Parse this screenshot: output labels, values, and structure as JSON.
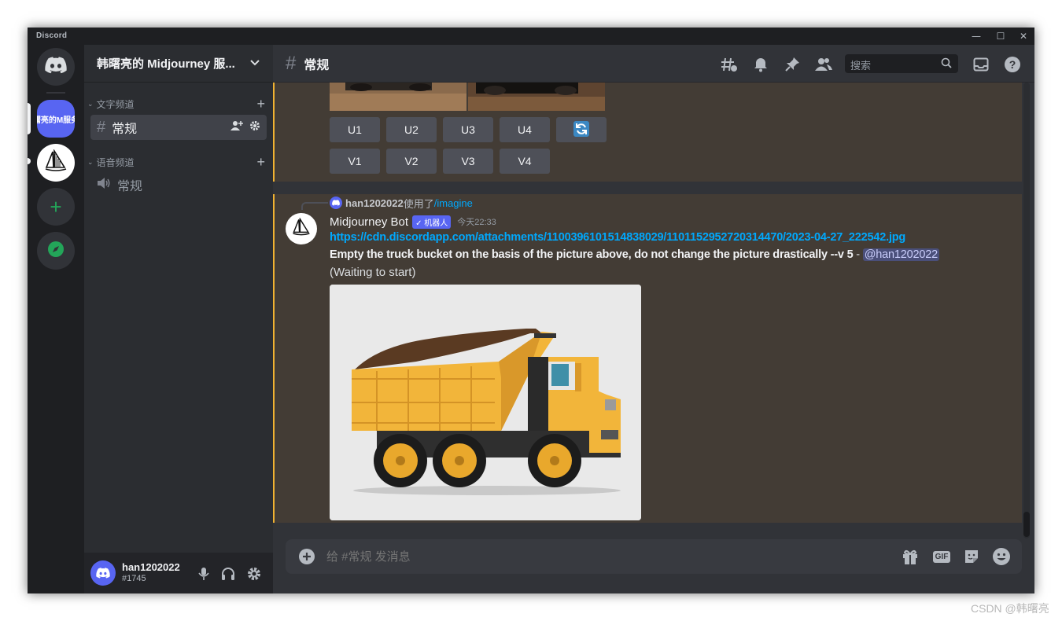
{
  "window": {
    "app_name": "Discord",
    "controls": {
      "minimize": "—",
      "maximize": "☐",
      "close": "✕"
    }
  },
  "servers": {
    "items": [
      {
        "name": "home",
        "icon": "discord-logo"
      },
      {
        "name": "韩曙亮的M服务器",
        "abbr": "曙亮的M服务",
        "selected": true
      },
      {
        "name": "midjourney",
        "icon": "sailboat-icon"
      },
      {
        "name": "add-server",
        "icon": "plus-icon"
      },
      {
        "name": "explore",
        "icon": "compass-icon"
      }
    ]
  },
  "sidebar": {
    "guild_name": "韩曙亮的 Midjourney 服...",
    "categories": [
      {
        "label": "文字频道",
        "channels": [
          {
            "name": "常规",
            "type": "text",
            "active": true
          }
        ]
      },
      {
        "label": "语音频道",
        "channels": [
          {
            "name": "常规",
            "type": "voice"
          }
        ]
      }
    ]
  },
  "user": {
    "name": "han1202022",
    "tag": "#1745"
  },
  "channel_header": {
    "name": "常规",
    "search_placeholder": "搜索",
    "icons": [
      "threads-icon",
      "bell-icon",
      "pin-icon",
      "members-icon",
      "inbox-icon",
      "help-icon"
    ]
  },
  "previous_message": {
    "buttons_row1": [
      "U1",
      "U2",
      "U3",
      "U4"
    ],
    "reroll_icon": "refresh-icon",
    "buttons_row2": [
      "V1",
      "V2",
      "V3",
      "V4"
    ]
  },
  "message": {
    "reply_user": "han1202022",
    "reply_action": "使用了",
    "reply_command": "/imagine",
    "author": "Midjourney Bot",
    "bot_badge": "✓ 机器人",
    "timestamp": "今天22:33",
    "link": "https://cdn.discordapp.com/attachments/1100396101514838029/1101152952720314470/2023-04-27_222542.jpg",
    "prompt": "Empty the truck bucket on the basis of the picture above, do not change the picture drastically --v 5",
    "separator": " - ",
    "mention": "@han1202022",
    "status": "(Waiting to start)"
  },
  "composer": {
    "placeholder": "给 #常规 发消息",
    "gif_label": "GIF",
    "icons": [
      "add-attachment-icon",
      "gift-icon",
      "gif-icon",
      "sticker-icon",
      "emoji-icon"
    ]
  },
  "watermark": "CSDN @韩曙亮",
  "colors": {
    "accent": "#5865f2",
    "link": "#00a8fc",
    "mention_bg": "#4a4f7a",
    "highlight_bar": "#f0b232",
    "highlight_bg": "#433c35",
    "green": "#23a559"
  }
}
